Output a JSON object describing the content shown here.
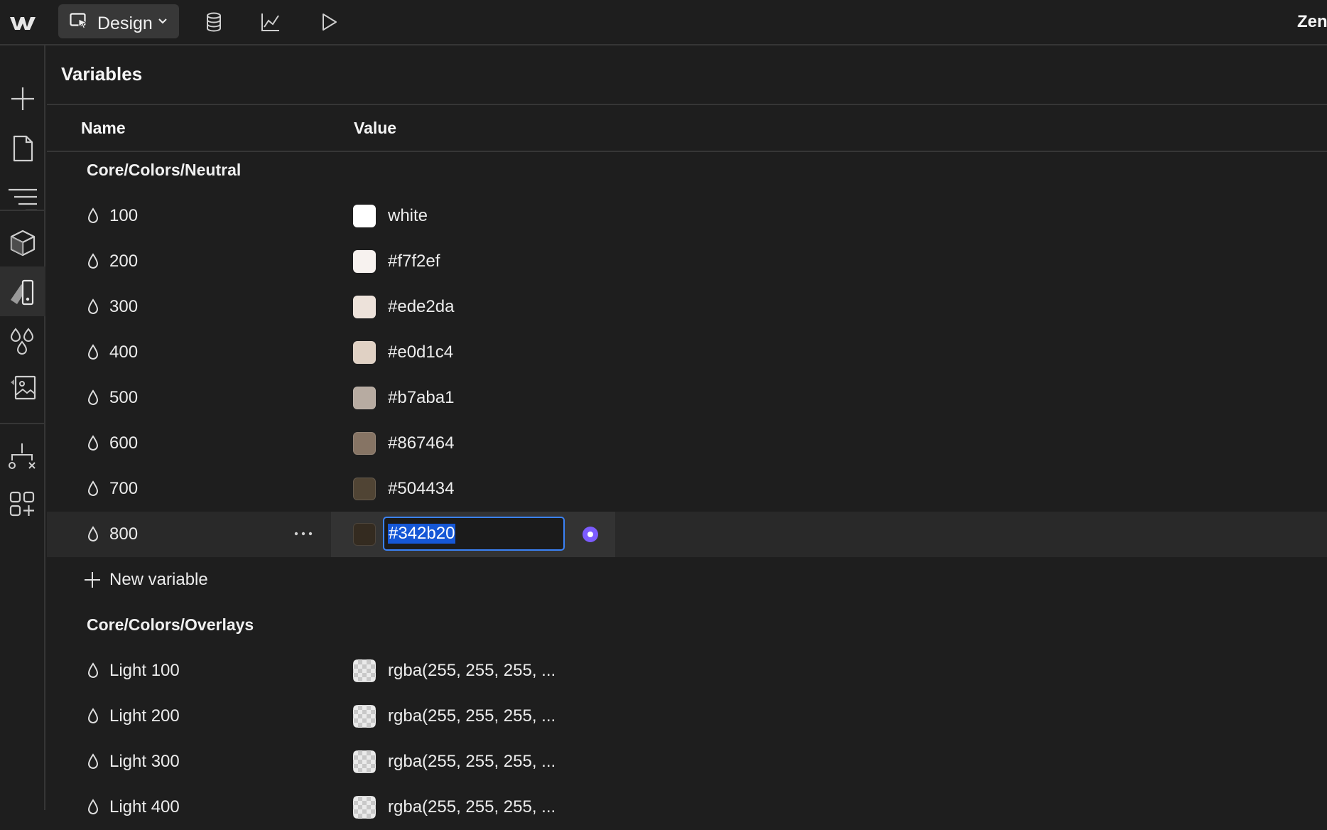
{
  "topbar": {
    "mode_label": "Design",
    "user_name": "Zen",
    "icons": [
      "webflow-logo",
      "cursor-icon",
      "chevron-down-icon",
      "database-icon",
      "analytics-icon",
      "play-icon"
    ]
  },
  "rail": {
    "icons": [
      "add-icon",
      "page-icon",
      "navigator-icon",
      "components-icon",
      "style-manager-icon",
      "variables-icon",
      "assets-icon",
      "logic-icon",
      "apps-icon"
    ],
    "active": "style-manager-icon"
  },
  "panel": {
    "title": "Variables",
    "columns": {
      "name": "Name",
      "value": "Value"
    }
  },
  "groups": [
    {
      "title": "Core/Colors/Neutral",
      "variables": [
        {
          "name": "100",
          "value": "white",
          "swatch": "#ffffff"
        },
        {
          "name": "200",
          "value": "#f7f2ef",
          "swatch": "#f7f2ef"
        },
        {
          "name": "300",
          "value": "#ede2da",
          "swatch": "#ede2da"
        },
        {
          "name": "400",
          "value": "#e0d1c4",
          "swatch": "#e0d1c4"
        },
        {
          "name": "500",
          "value": "#b7aba1",
          "swatch": "#b7aba1"
        },
        {
          "name": "600",
          "value": "#867464",
          "swatch": "#867464"
        },
        {
          "name": "700",
          "value": "#504434",
          "swatch": "#504434"
        },
        {
          "name": "800",
          "value": "#342b20",
          "swatch": "#342b20",
          "editing": true
        }
      ],
      "new_variable_label": "New variable"
    },
    {
      "title": "Core/Colors/Overlays",
      "variables": [
        {
          "name": "Light 100",
          "value": "rgba(255, 255, 255, ..."
        },
        {
          "name": "Light 200",
          "value": "rgba(255, 255, 255, ..."
        },
        {
          "name": "Light 300",
          "value": "rgba(255, 255, 255, ..."
        },
        {
          "name": "Light 400",
          "value": "rgba(255, 255, 255, ..."
        }
      ]
    }
  ],
  "colors": {
    "accent_blue": "#3b82f6",
    "mode_dot": "#7c5cff"
  }
}
